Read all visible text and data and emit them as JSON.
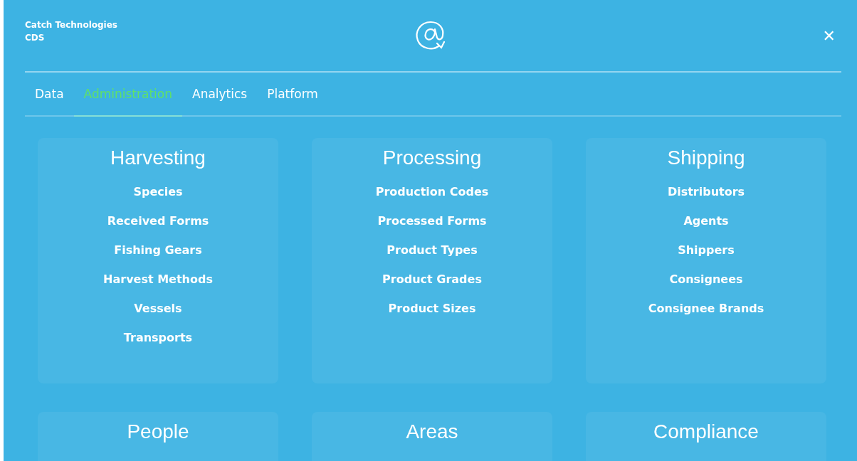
{
  "header": {
    "company": "Catch Technologies",
    "product": "CDS",
    "close": "✕"
  },
  "tabs": [
    {
      "label": "Data",
      "selected": false
    },
    {
      "label": "Administration",
      "selected": true
    },
    {
      "label": "Analytics",
      "selected": false
    },
    {
      "label": "Platform",
      "selected": false
    }
  ],
  "sections": [
    {
      "title": "Harvesting",
      "items": [
        "Species",
        "Received Forms",
        "Fishing Gears",
        "Harvest Methods",
        "Vessels",
        "Transports"
      ]
    },
    {
      "title": "Processing",
      "items": [
        "Production Codes",
        "Processed Forms",
        "Product Types",
        "Product Grades",
        "Product Sizes"
      ]
    },
    {
      "title": "Shipping",
      "items": [
        "Distributors",
        "Agents",
        "Shippers",
        "Consignees",
        "Consignee Brands"
      ]
    },
    {
      "title": "People"
    },
    {
      "title": "Areas"
    },
    {
      "title": "Compliance"
    }
  ]
}
